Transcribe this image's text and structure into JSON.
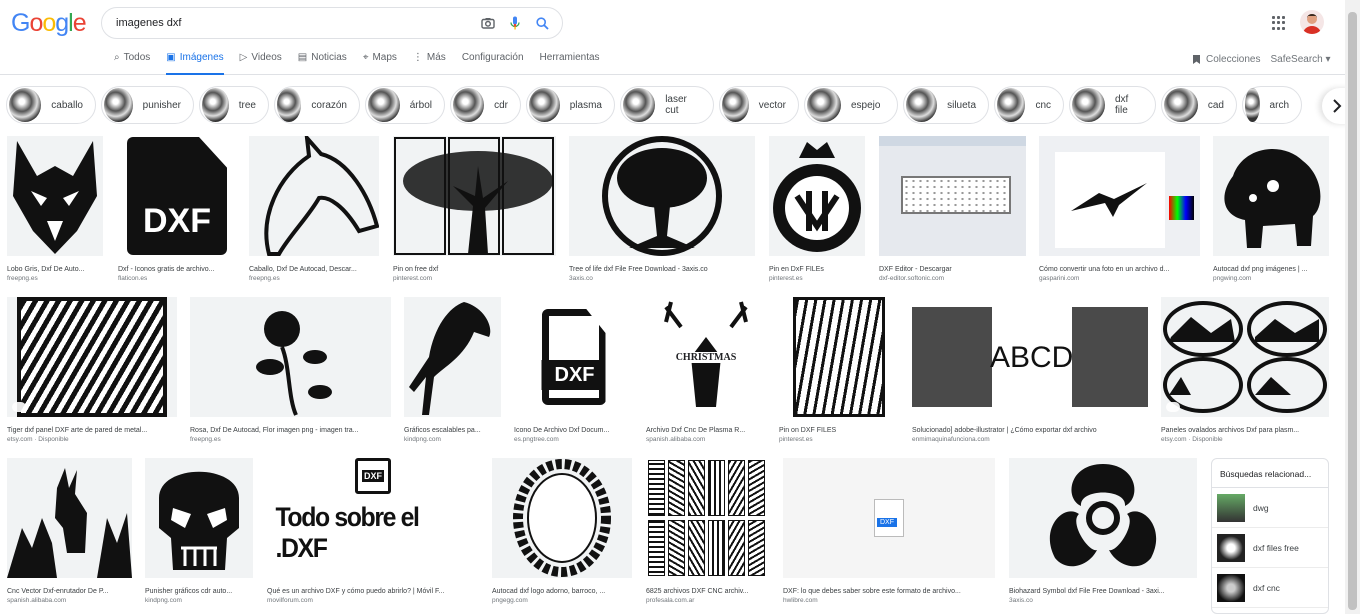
{
  "logo": "Google",
  "search": {
    "value": "imagenes dxf"
  },
  "tabs": [
    {
      "label": "Todos",
      "icon": "search-icon",
      "glyph": "⌕"
    },
    {
      "label": "Imágenes",
      "icon": "image-icon",
      "glyph": "▣",
      "active": true
    },
    {
      "label": "Videos",
      "icon": "video-icon",
      "glyph": "▷"
    },
    {
      "label": "Noticias",
      "icon": "news-icon",
      "glyph": "▤"
    },
    {
      "label": "Maps",
      "icon": "map-pin-icon",
      "glyph": "⌖"
    },
    {
      "label": "Más",
      "icon": "more-vert-icon",
      "glyph": "⋮"
    },
    {
      "label": "Configuración",
      "icon": "",
      "glyph": ""
    },
    {
      "label": "Herramientas",
      "icon": "",
      "glyph": ""
    }
  ],
  "right_links": {
    "collections": "Colecciones",
    "safesearch": "SafeSearch"
  },
  "chips": [
    "caballo",
    "punisher",
    "tree",
    "corazón",
    "árbol",
    "cdr",
    "plasma",
    "laser cut",
    "vector",
    "espejo",
    "silueta",
    "cnc",
    "dxf file",
    "cad",
    "arch"
  ],
  "results": [
    {
      "caption": "Lobo Gris, Dxf De Auto...",
      "source": "freepng.es"
    },
    {
      "caption": "Dxf - Iconos gratis de archivo...",
      "source": "flaticon.es"
    },
    {
      "caption": "Caballo, Dxf De Autocad, Descar...",
      "source": "freepng.es"
    },
    {
      "caption": "Pin on free dxf",
      "source": "pinterest.com"
    },
    {
      "caption": "Tree of life dxf File Free Download - 3axis.co",
      "source": "3axis.co"
    },
    {
      "caption": "Pin en DxF FILEs",
      "source": "pinterest.es"
    },
    {
      "caption": "DXF Editor - Descargar",
      "source": "dxf-editor.softonic.com"
    },
    {
      "caption": "Cómo convertir una foto en un archivo d...",
      "source": "gasparini.com"
    },
    {
      "caption": "Autocad dxf png imágenes | ...",
      "source": "pngwing.com"
    },
    {
      "caption": "Tiger dxf panel DXF arte de pared de metal...",
      "source": "etsy.com · Disponible"
    },
    {
      "caption": "Rosa, Dxf De Autocad, Flor imagen png - imagen tra...",
      "source": "freepng.es"
    },
    {
      "caption": "Gráficos escalables pa...",
      "source": "kindpng.com"
    },
    {
      "caption": "Icono De Archivo Dxf Docum...",
      "source": "es.pngtree.com"
    },
    {
      "caption": "Archivo Dxf Cnc De Plasma R...",
      "source": "spanish.alibaba.com"
    },
    {
      "caption": "Pin on DXF FILES",
      "source": "pinterest.es"
    },
    {
      "caption": "Solucionado] adobe-illustrator | ¿Cómo exportar dxf archivo",
      "source": "enmimaquinafunciona.com"
    },
    {
      "caption": "Paneles ovalados archivos Dxf para plasm...",
      "source": "etsy.com · Disponible"
    },
    {
      "caption": "Cnc Vector Dxf-enrutador De P...",
      "source": "spanish.alibaba.com"
    },
    {
      "caption": "Punisher gráficos cdr auto...",
      "source": "kindpng.com"
    },
    {
      "caption": "Qué es un archivo DXF y cómo puedo abrirlo? | Móvil F...",
      "source": "movilforum.com"
    },
    {
      "caption": "Autocad dxf logo adorno, barroco, ...",
      "source": "pngegg.com"
    },
    {
      "caption": "6825 archivos DXF CNC archiv...",
      "source": "profesala.com.ar"
    },
    {
      "caption": "DXF: lo que debes saber sobre este formato de archivo...",
      "source": "hwlibre.com"
    },
    {
      "caption": "Biohazard Symbol dxf File Free Download - 3axi...",
      "source": "3axis.co"
    }
  ],
  "image_text": {
    "dxf": "DXF",
    "christmas": "CHRISTMAS",
    "abcd": "ABCD",
    "todo": "Todo sobre el .DXF"
  },
  "related": {
    "title": "Búsquedas relacionad...",
    "items": [
      "dwg",
      "dxf files free",
      "dxf cnc"
    ]
  }
}
